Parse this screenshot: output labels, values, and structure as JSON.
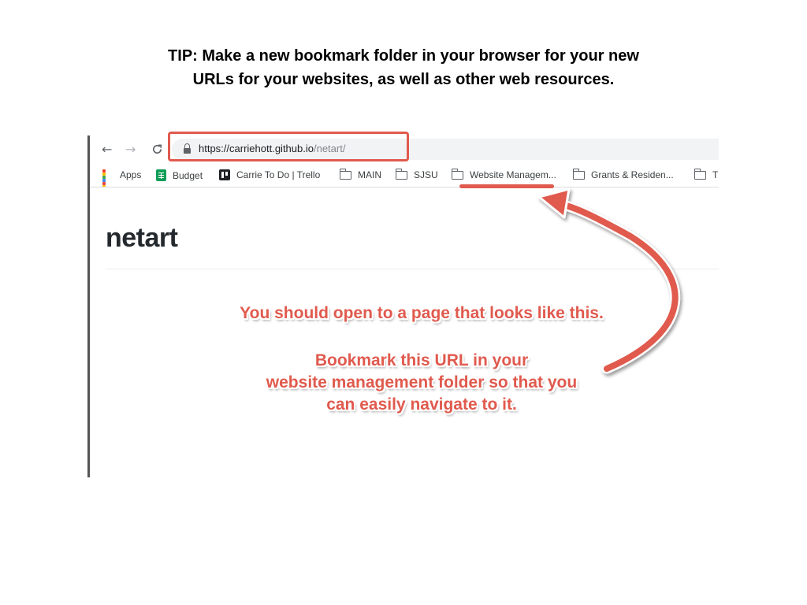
{
  "tip": {
    "line1": "TIP: Make a new bookmark folder in your browser for your new",
    "line2": "URLs for your websites, as well as other web resources."
  },
  "browser": {
    "nav": {
      "back_icon": "←",
      "forward_icon": "→",
      "reload_icon": "C"
    },
    "url_host": "https://carriehott.github.io",
    "url_path": "/netart/",
    "bookmarks": [
      {
        "label": "Apps",
        "icon": "apps-grid-icon"
      },
      {
        "label": "Budget",
        "icon": "sheets-icon"
      },
      {
        "label": "Carrie To Do | Trello",
        "icon": "trello-icon"
      },
      {
        "label": "MAIN",
        "icon": "folder-icon"
      },
      {
        "label": "SJSU",
        "icon": "folder-icon"
      },
      {
        "label": "Website Managem...",
        "icon": "folder-icon"
      },
      {
        "label": "Grants & Residen...",
        "icon": "folder-icon"
      },
      {
        "label": "T",
        "icon": "folder-icon"
      }
    ]
  },
  "page": {
    "title": "netart"
  },
  "callouts": {
    "line1": "You should open to a page that looks like this.",
    "line2": "Bookmark this URL in your",
    "line3": "website management folder so that you",
    "line4": "can easily navigate to it."
  },
  "colors": {
    "accent": "#e05a4e",
    "sheets_green": "#0f9d58",
    "apps_grid": [
      "#ea4335",
      "#fbbc05",
      "#34a853",
      "#4285f4",
      "#ea4335",
      "#fbbc05",
      "#34a853",
      "#4285f4",
      "#ea4335"
    ]
  }
}
